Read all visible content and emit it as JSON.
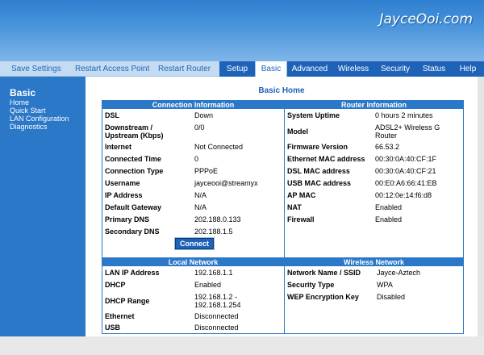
{
  "header": {
    "watermark": "JayceOoi.com"
  },
  "utility_links": {
    "save": "Save Settings",
    "restart_ap": "Restart Access Point",
    "restart_router": "Restart Router"
  },
  "tabs": [
    "Setup",
    "Basic",
    "Advanced",
    "Wireless",
    "Security",
    "Status",
    "Help"
  ],
  "active_tab": "Basic",
  "sidebar": {
    "title": "Basic",
    "items": [
      "Home",
      "Quick Start",
      "LAN Configuration",
      "Diagnostics"
    ]
  },
  "page_title": "Basic Home",
  "connection": {
    "title": "Connection Information",
    "rows": [
      {
        "label": "DSL",
        "value": "Down"
      },
      {
        "label": "Downstream / Upstream (Kbps)",
        "value": "0/0"
      },
      {
        "label": "Internet",
        "value": "Not Connected"
      },
      {
        "label": "Connected Time",
        "value": "0"
      },
      {
        "label": "Connection Type",
        "value": "PPPoE"
      },
      {
        "label": "Username",
        "value": "jayceooi@streamyx"
      },
      {
        "label": "IP Address",
        "value": "N/A"
      },
      {
        "label": "Default Gateway",
        "value": "N/A"
      },
      {
        "label": "Primary DNS",
        "value": "202.188.0.133"
      },
      {
        "label": "Secondary DNS",
        "value": "202.188.1.5"
      }
    ],
    "button": "Connect"
  },
  "router": {
    "title": "Router Information",
    "rows": [
      {
        "label": "System Uptime",
        "value": "0 hours 2 minutes"
      },
      {
        "label": "Model",
        "value": "ADSL2+ Wireless G Router"
      },
      {
        "label": "Firmware Version",
        "value": "66.53.2"
      },
      {
        "label": "Ethernet MAC address",
        "value": "00:30:0A:40:CF:1F"
      },
      {
        "label": "DSL MAC address",
        "value": "00:30:0A:40:CF:21"
      },
      {
        "label": "USB MAC address",
        "value": "00:E0:A6:66:41:EB"
      },
      {
        "label": "AP MAC",
        "value": "00:12:0e:14:f6:d8"
      },
      {
        "label": "NAT",
        "value": "Enabled"
      },
      {
        "label": "Firewall",
        "value": "Enabled"
      }
    ]
  },
  "local_network": {
    "title": "Local Network",
    "rows": [
      {
        "label": "LAN IP Address",
        "value": "192.168.1.1"
      },
      {
        "label": "DHCP",
        "value": "Enabled"
      },
      {
        "label": "DHCP Range",
        "value": "192.168.1.2 - 192.168.1.254"
      },
      {
        "label": "Ethernet",
        "value": "Disconnected"
      },
      {
        "label": "USB",
        "value": "Disconnected"
      }
    ]
  },
  "wireless_network": {
    "title": "Wireless Network",
    "rows": [
      {
        "label": "Network Name / SSID",
        "value": "Jayce-Aztech"
      },
      {
        "label": "Security Type",
        "value": "WPA"
      },
      {
        "label": "WEP Encryption Key",
        "value": "Disabled"
      }
    ]
  }
}
